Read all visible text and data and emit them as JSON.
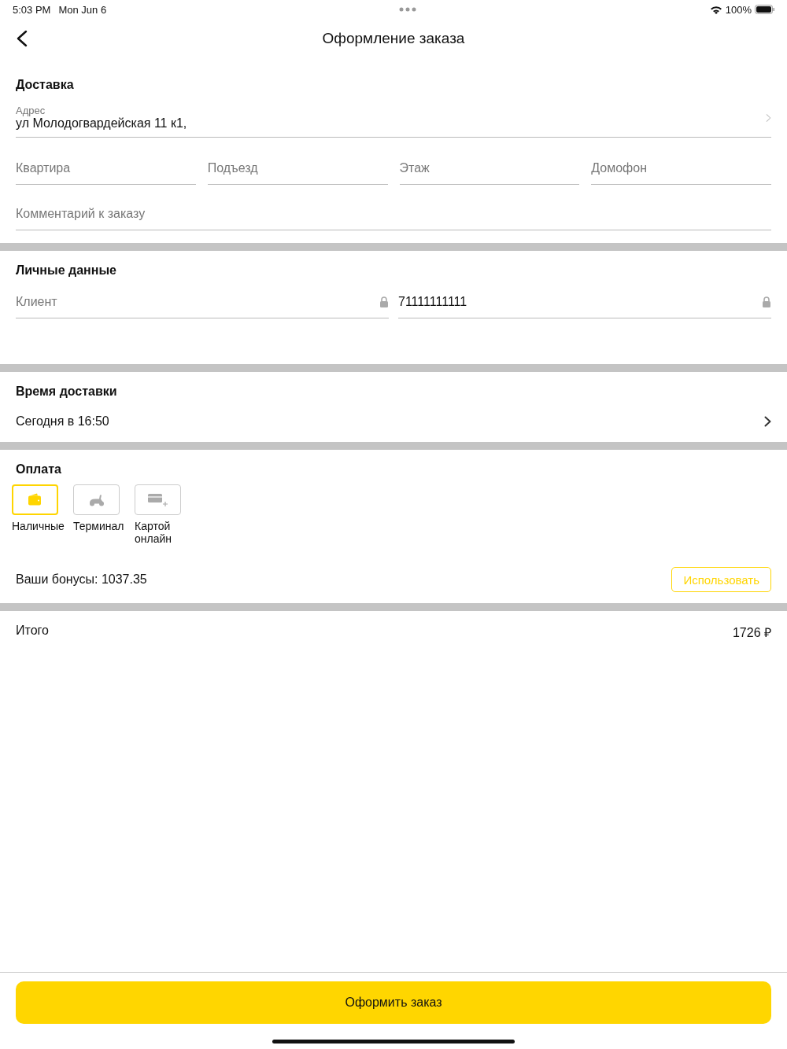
{
  "status_bar": {
    "time": "5:03 PM",
    "date": "Mon Jun 6",
    "battery": "100%"
  },
  "header": {
    "title": "Оформление заказа"
  },
  "delivery": {
    "title": "Доставка",
    "address": {
      "label": "Адрес",
      "value": "ул Молодогвардейская 11 к1,"
    },
    "fields": [
      {
        "placeholder": "Квартира"
      },
      {
        "placeholder": "Подъезд"
      },
      {
        "placeholder": "Этаж"
      },
      {
        "placeholder": "Домофон"
      }
    ],
    "comment": {
      "placeholder": "Комментарий к заказу"
    }
  },
  "personal": {
    "title": "Личные данные",
    "fields": [
      {
        "placeholder": "Клиент",
        "locked": true
      },
      {
        "value": "71111111111",
        "locked": true
      }
    ]
  },
  "delivery_time": {
    "title": "Время доставки",
    "value": "Сегодня в 16:50"
  },
  "payment": {
    "title": "Оплата",
    "options": [
      {
        "kind": "cash",
        "label": "Наличные",
        "selected": true
      },
      {
        "kind": "terminal",
        "label": "Терминал",
        "selected": false
      },
      {
        "kind": "card",
        "label": "Картой онлайн",
        "selected": false
      }
    ],
    "bonus": {
      "text": "Ваши бонусы: 1037.35",
      "button": "Использовать"
    }
  },
  "total": {
    "label": "Итого",
    "value": "1726 ₽"
  },
  "submit": {
    "label": "Оформить заказ"
  }
}
